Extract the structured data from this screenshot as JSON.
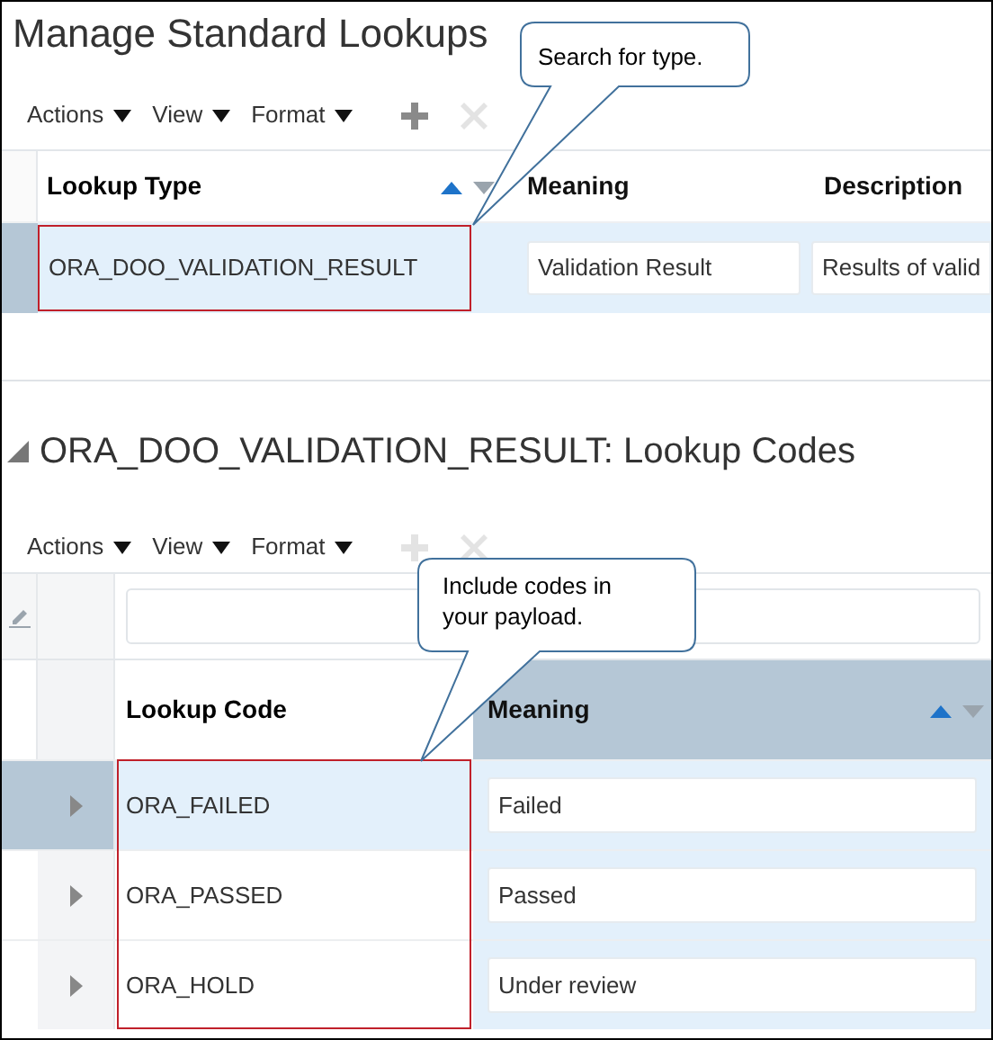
{
  "title": "Manage Standard Lookups",
  "toolbar": {
    "menus": [
      "Actions",
      "View",
      "Format"
    ],
    "add_disabled": false,
    "delete_disabled": true
  },
  "lookup_types": {
    "columns": [
      {
        "label": "Lookup Type",
        "sorted": true,
        "highlighted": true
      },
      {
        "label": "Meaning",
        "sorted": false,
        "highlighted": false
      },
      {
        "label": "Description",
        "sorted": false,
        "highlighted": false
      }
    ],
    "rows": [
      {
        "selected": true,
        "lookup_type": "ORA_DOO_VALIDATION_RESULT",
        "meaning": "Validation Result",
        "description": "Results of valid"
      }
    ]
  },
  "callout_top": "Search for type.",
  "section": {
    "heading": "ORA_DOO_VALIDATION_RESULT: Lookup Codes",
    "expanded": true
  },
  "toolbar_codes": {
    "menus": [
      "Actions",
      "View",
      "Format"
    ],
    "add_disabled": true,
    "delete_disabled": true
  },
  "lookup_codes": {
    "columns": [
      {
        "label": "Lookup Code",
        "sorted": false,
        "highlighted": true
      },
      {
        "label": "Meaning",
        "sorted": true,
        "highlighted": false
      }
    ],
    "rows": [
      {
        "selected": true,
        "code": "ORA_FAILED",
        "meaning": "Failed"
      },
      {
        "selected": false,
        "code": "ORA_PASSED",
        "meaning": "Passed"
      },
      {
        "selected": false,
        "code": "ORA_HOLD",
        "meaning": "Under review"
      }
    ]
  },
  "callout_bottom": "Include codes in your payload."
}
